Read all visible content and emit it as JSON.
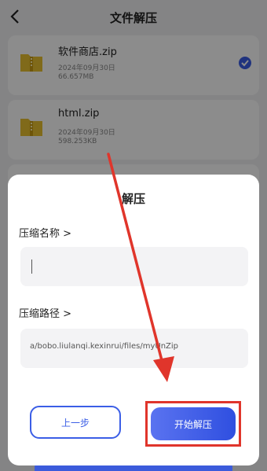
{
  "header": {
    "title": "文件解压"
  },
  "files": [
    {
      "name": "软件商店.zip",
      "date": "2024年09月30日",
      "size": "66.657MB",
      "selected": true
    },
    {
      "name": "html.zip",
      "date": "2024年09月30日",
      "size": "598.253KB",
      "selected": false
    }
  ],
  "dialog": {
    "title": "解压",
    "name_label": "压缩名称 >",
    "name_value": "",
    "path_label": "压缩路径 >",
    "path_value": "a/bobo.liulanqi.kexinrui/files/myUnZip",
    "prev_button": "上一步",
    "start_button": "开始解压"
  },
  "colors": {
    "accent": "#3b5ee6",
    "folder": "#e9c230",
    "annotation": "#e0352b"
  }
}
